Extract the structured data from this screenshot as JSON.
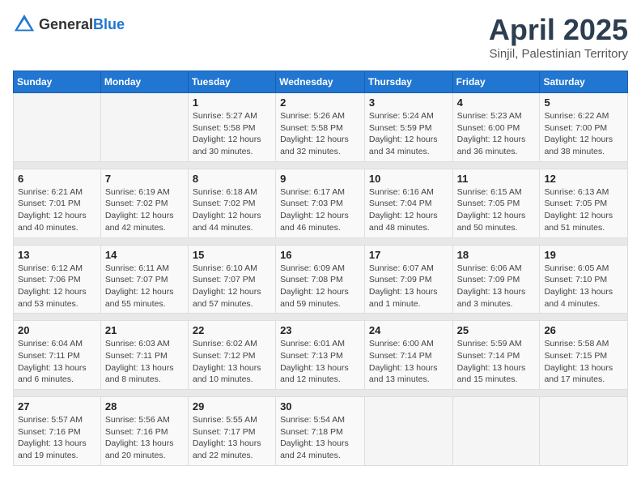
{
  "header": {
    "logo_general": "General",
    "logo_blue": "Blue",
    "title": "April 2025",
    "subtitle": "Sinjil, Palestinian Territory"
  },
  "weekdays": [
    "Sunday",
    "Monday",
    "Tuesday",
    "Wednesday",
    "Thursday",
    "Friday",
    "Saturday"
  ],
  "weeks": [
    [
      {
        "day": null
      },
      {
        "day": null
      },
      {
        "day": "1",
        "sunrise": "Sunrise: 5:27 AM",
        "sunset": "Sunset: 5:58 PM",
        "daylight": "Daylight: 12 hours and 30 minutes."
      },
      {
        "day": "2",
        "sunrise": "Sunrise: 5:26 AM",
        "sunset": "Sunset: 5:58 PM",
        "daylight": "Daylight: 12 hours and 32 minutes."
      },
      {
        "day": "3",
        "sunrise": "Sunrise: 5:24 AM",
        "sunset": "Sunset: 5:59 PM",
        "daylight": "Daylight: 12 hours and 34 minutes."
      },
      {
        "day": "4",
        "sunrise": "Sunrise: 5:23 AM",
        "sunset": "Sunset: 6:00 PM",
        "daylight": "Daylight: 12 hours and 36 minutes."
      },
      {
        "day": "5",
        "sunrise": "Sunrise: 6:22 AM",
        "sunset": "Sunset: 7:00 PM",
        "daylight": "Daylight: 12 hours and 38 minutes."
      }
    ],
    [
      {
        "day": "6",
        "sunrise": "Sunrise: 6:21 AM",
        "sunset": "Sunset: 7:01 PM",
        "daylight": "Daylight: 12 hours and 40 minutes."
      },
      {
        "day": "7",
        "sunrise": "Sunrise: 6:19 AM",
        "sunset": "Sunset: 7:02 PM",
        "daylight": "Daylight: 12 hours and 42 minutes."
      },
      {
        "day": "8",
        "sunrise": "Sunrise: 6:18 AM",
        "sunset": "Sunset: 7:02 PM",
        "daylight": "Daylight: 12 hours and 44 minutes."
      },
      {
        "day": "9",
        "sunrise": "Sunrise: 6:17 AM",
        "sunset": "Sunset: 7:03 PM",
        "daylight": "Daylight: 12 hours and 46 minutes."
      },
      {
        "day": "10",
        "sunrise": "Sunrise: 6:16 AM",
        "sunset": "Sunset: 7:04 PM",
        "daylight": "Daylight: 12 hours and 48 minutes."
      },
      {
        "day": "11",
        "sunrise": "Sunrise: 6:15 AM",
        "sunset": "Sunset: 7:05 PM",
        "daylight": "Daylight: 12 hours and 50 minutes."
      },
      {
        "day": "12",
        "sunrise": "Sunrise: 6:13 AM",
        "sunset": "Sunset: 7:05 PM",
        "daylight": "Daylight: 12 hours and 51 minutes."
      }
    ],
    [
      {
        "day": "13",
        "sunrise": "Sunrise: 6:12 AM",
        "sunset": "Sunset: 7:06 PM",
        "daylight": "Daylight: 12 hours and 53 minutes."
      },
      {
        "day": "14",
        "sunrise": "Sunrise: 6:11 AM",
        "sunset": "Sunset: 7:07 PM",
        "daylight": "Daylight: 12 hours and 55 minutes."
      },
      {
        "day": "15",
        "sunrise": "Sunrise: 6:10 AM",
        "sunset": "Sunset: 7:07 PM",
        "daylight": "Daylight: 12 hours and 57 minutes."
      },
      {
        "day": "16",
        "sunrise": "Sunrise: 6:09 AM",
        "sunset": "Sunset: 7:08 PM",
        "daylight": "Daylight: 12 hours and 59 minutes."
      },
      {
        "day": "17",
        "sunrise": "Sunrise: 6:07 AM",
        "sunset": "Sunset: 7:09 PM",
        "daylight": "Daylight: 13 hours and 1 minute."
      },
      {
        "day": "18",
        "sunrise": "Sunrise: 6:06 AM",
        "sunset": "Sunset: 7:09 PM",
        "daylight": "Daylight: 13 hours and 3 minutes."
      },
      {
        "day": "19",
        "sunrise": "Sunrise: 6:05 AM",
        "sunset": "Sunset: 7:10 PM",
        "daylight": "Daylight: 13 hours and 4 minutes."
      }
    ],
    [
      {
        "day": "20",
        "sunrise": "Sunrise: 6:04 AM",
        "sunset": "Sunset: 7:11 PM",
        "daylight": "Daylight: 13 hours and 6 minutes."
      },
      {
        "day": "21",
        "sunrise": "Sunrise: 6:03 AM",
        "sunset": "Sunset: 7:11 PM",
        "daylight": "Daylight: 13 hours and 8 minutes."
      },
      {
        "day": "22",
        "sunrise": "Sunrise: 6:02 AM",
        "sunset": "Sunset: 7:12 PM",
        "daylight": "Daylight: 13 hours and 10 minutes."
      },
      {
        "day": "23",
        "sunrise": "Sunrise: 6:01 AM",
        "sunset": "Sunset: 7:13 PM",
        "daylight": "Daylight: 13 hours and 12 minutes."
      },
      {
        "day": "24",
        "sunrise": "Sunrise: 6:00 AM",
        "sunset": "Sunset: 7:14 PM",
        "daylight": "Daylight: 13 hours and 13 minutes."
      },
      {
        "day": "25",
        "sunrise": "Sunrise: 5:59 AM",
        "sunset": "Sunset: 7:14 PM",
        "daylight": "Daylight: 13 hours and 15 minutes."
      },
      {
        "day": "26",
        "sunrise": "Sunrise: 5:58 AM",
        "sunset": "Sunset: 7:15 PM",
        "daylight": "Daylight: 13 hours and 17 minutes."
      }
    ],
    [
      {
        "day": "27",
        "sunrise": "Sunrise: 5:57 AM",
        "sunset": "Sunset: 7:16 PM",
        "daylight": "Daylight: 13 hours and 19 minutes."
      },
      {
        "day": "28",
        "sunrise": "Sunrise: 5:56 AM",
        "sunset": "Sunset: 7:16 PM",
        "daylight": "Daylight: 13 hours and 20 minutes."
      },
      {
        "day": "29",
        "sunrise": "Sunrise: 5:55 AM",
        "sunset": "Sunset: 7:17 PM",
        "daylight": "Daylight: 13 hours and 22 minutes."
      },
      {
        "day": "30",
        "sunrise": "Sunrise: 5:54 AM",
        "sunset": "Sunset: 7:18 PM",
        "daylight": "Daylight: 13 hours and 24 minutes."
      },
      {
        "day": null
      },
      {
        "day": null
      },
      {
        "day": null
      }
    ]
  ]
}
